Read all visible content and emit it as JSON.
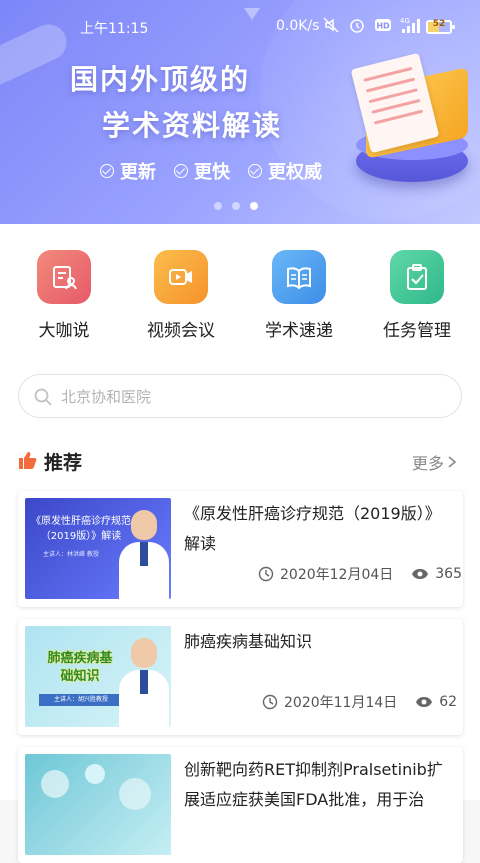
{
  "status_bar": {
    "time": "上午11:15",
    "network_speed": "0.0K/s",
    "battery": "52",
    "battery_level": 52
  },
  "banner": {
    "title_line1": "国内外顶级的",
    "title_line2": "学术资料解读",
    "tags": [
      "更新",
      "更快",
      "更权威"
    ],
    "slide_count": 3,
    "active_slide": 3
  },
  "quick_actions": [
    {
      "label": "大咖说",
      "icon": "presenter-icon",
      "color": "#ee6a6a"
    },
    {
      "label": "视频会议",
      "icon": "video-camera-icon",
      "color": "#f7a53b"
    },
    {
      "label": "学术速递",
      "icon": "book-icon",
      "color": "#4a9ff0"
    },
    {
      "label": "任务管理",
      "icon": "clipboard-check-icon",
      "color": "#3ec99a"
    }
  ],
  "search": {
    "placeholder": "北京协和医院"
  },
  "recommend": {
    "title": "推荐",
    "more": "更多"
  },
  "articles": [
    {
      "title": "《原发性肝癌诊疗规范（2019版）》解读",
      "date": "2020年12月04日",
      "views": "365",
      "thumb_title": "《原发性肝癌诊疗规范（2019版）》解读",
      "thumb_subtitle": "主讲人：林洪峰 教授"
    },
    {
      "title": "肺癌疾病基础知识",
      "date": "2020年11月14日",
      "views": "62",
      "thumb_title": "肺癌疾病基础知识",
      "thumb_subtitle": "主讲人：胡兴胜教授"
    },
    {
      "title": "创新靶向药RET抑制剂Pralsetinib扩展适应症获美国FDA批准，用于治"
    }
  ]
}
